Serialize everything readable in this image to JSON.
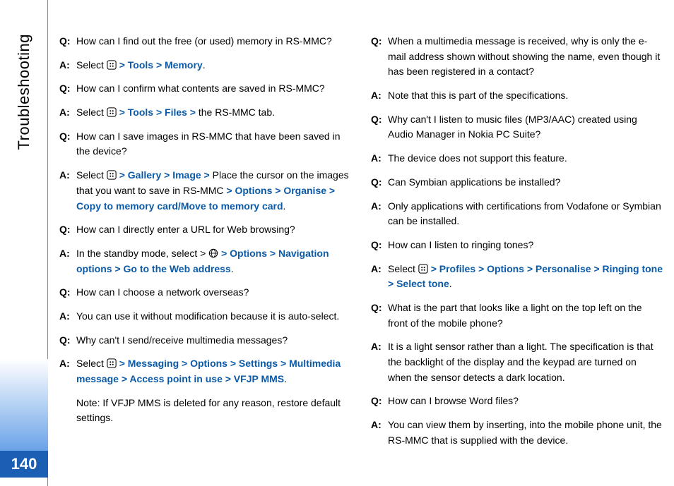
{
  "side_title": "Troubleshooting",
  "page_number": "140",
  "col1": {
    "q1": "How can I find out the free (or used) memory in RS-MMC?",
    "a1_pre": "Select ",
    "a1_link": " > Tools > Memory",
    "a1_post": ".",
    "q2": "How can I confirm what contents are saved in RS-MMC?",
    "a2_pre": "Select ",
    "a2_link": " > Tools > Files > ",
    "a2_post": "the RS-MMC tab.",
    "q3": "How can I save images in RS-MMC that have been saved in the device?",
    "a3_pre": " Select ",
    "a3_link1": " > Gallery > Image > ",
    "a3_mid": "Place the cursor on the images that you want to save in RS-MMC",
    "a3_link2": " > Options > Organise > Copy to memory card/Move to memory card",
    "a3_post": ".",
    "q4": "How can I directly enter a URL for Web browsing?",
    "a4_pre": "In the standby mode, select > ",
    "a4_link": " > Options > Navigation options > Go to the Web address",
    "a4_post": ".",
    "q5": "How can I choose a network overseas?",
    "a5": "You can use it without modification because it is auto-select.",
    "q6": "Why can't I send/receive multimedia messages?",
    "a6_pre": "Select ",
    "a6_link": " > Messaging > Options > Settings > Multimedia message > Access point in use > VFJP MMS",
    "a6_post": ".",
    "note": "Note: If VFJP MMS is deleted for any reason, restore default settings."
  },
  "col2": {
    "q1": "When a multimedia message is received, why is only the e-mail address shown without showing the name, even though it has been registered in a contact?",
    "a1": "Note that this is part of the specifications.",
    "q2": "Why can't I listen to music files (MP3/AAC) created using Audio Manager in Nokia PC Suite?",
    "a2": "The device does not support this feature.",
    "q3": "Can Symbian applications be installed?",
    "a3": "Only applications with certifications from Vodafone or Symbian can be installed.",
    "q4": "How can I listen to ringing tones?",
    "a4_pre": "Select ",
    "a4_link": " > Profiles > Options > Personalise > Ringing tone > Select tone",
    "a4_post": ".",
    "q5": "What is the part that looks like a light on the top left on the front of the mobile phone?",
    "a5": "It is a light sensor rather than a light. The specification is that the backlight of the display and the keypad are turned on when the sensor detects a dark location.",
    "q6": "How can I browse Word files?",
    "a6": "You can view them by inserting, into the mobile phone unit, the RS-MMC that is supplied with the device."
  },
  "labels": {
    "q": "Q:",
    "a": "A:"
  }
}
